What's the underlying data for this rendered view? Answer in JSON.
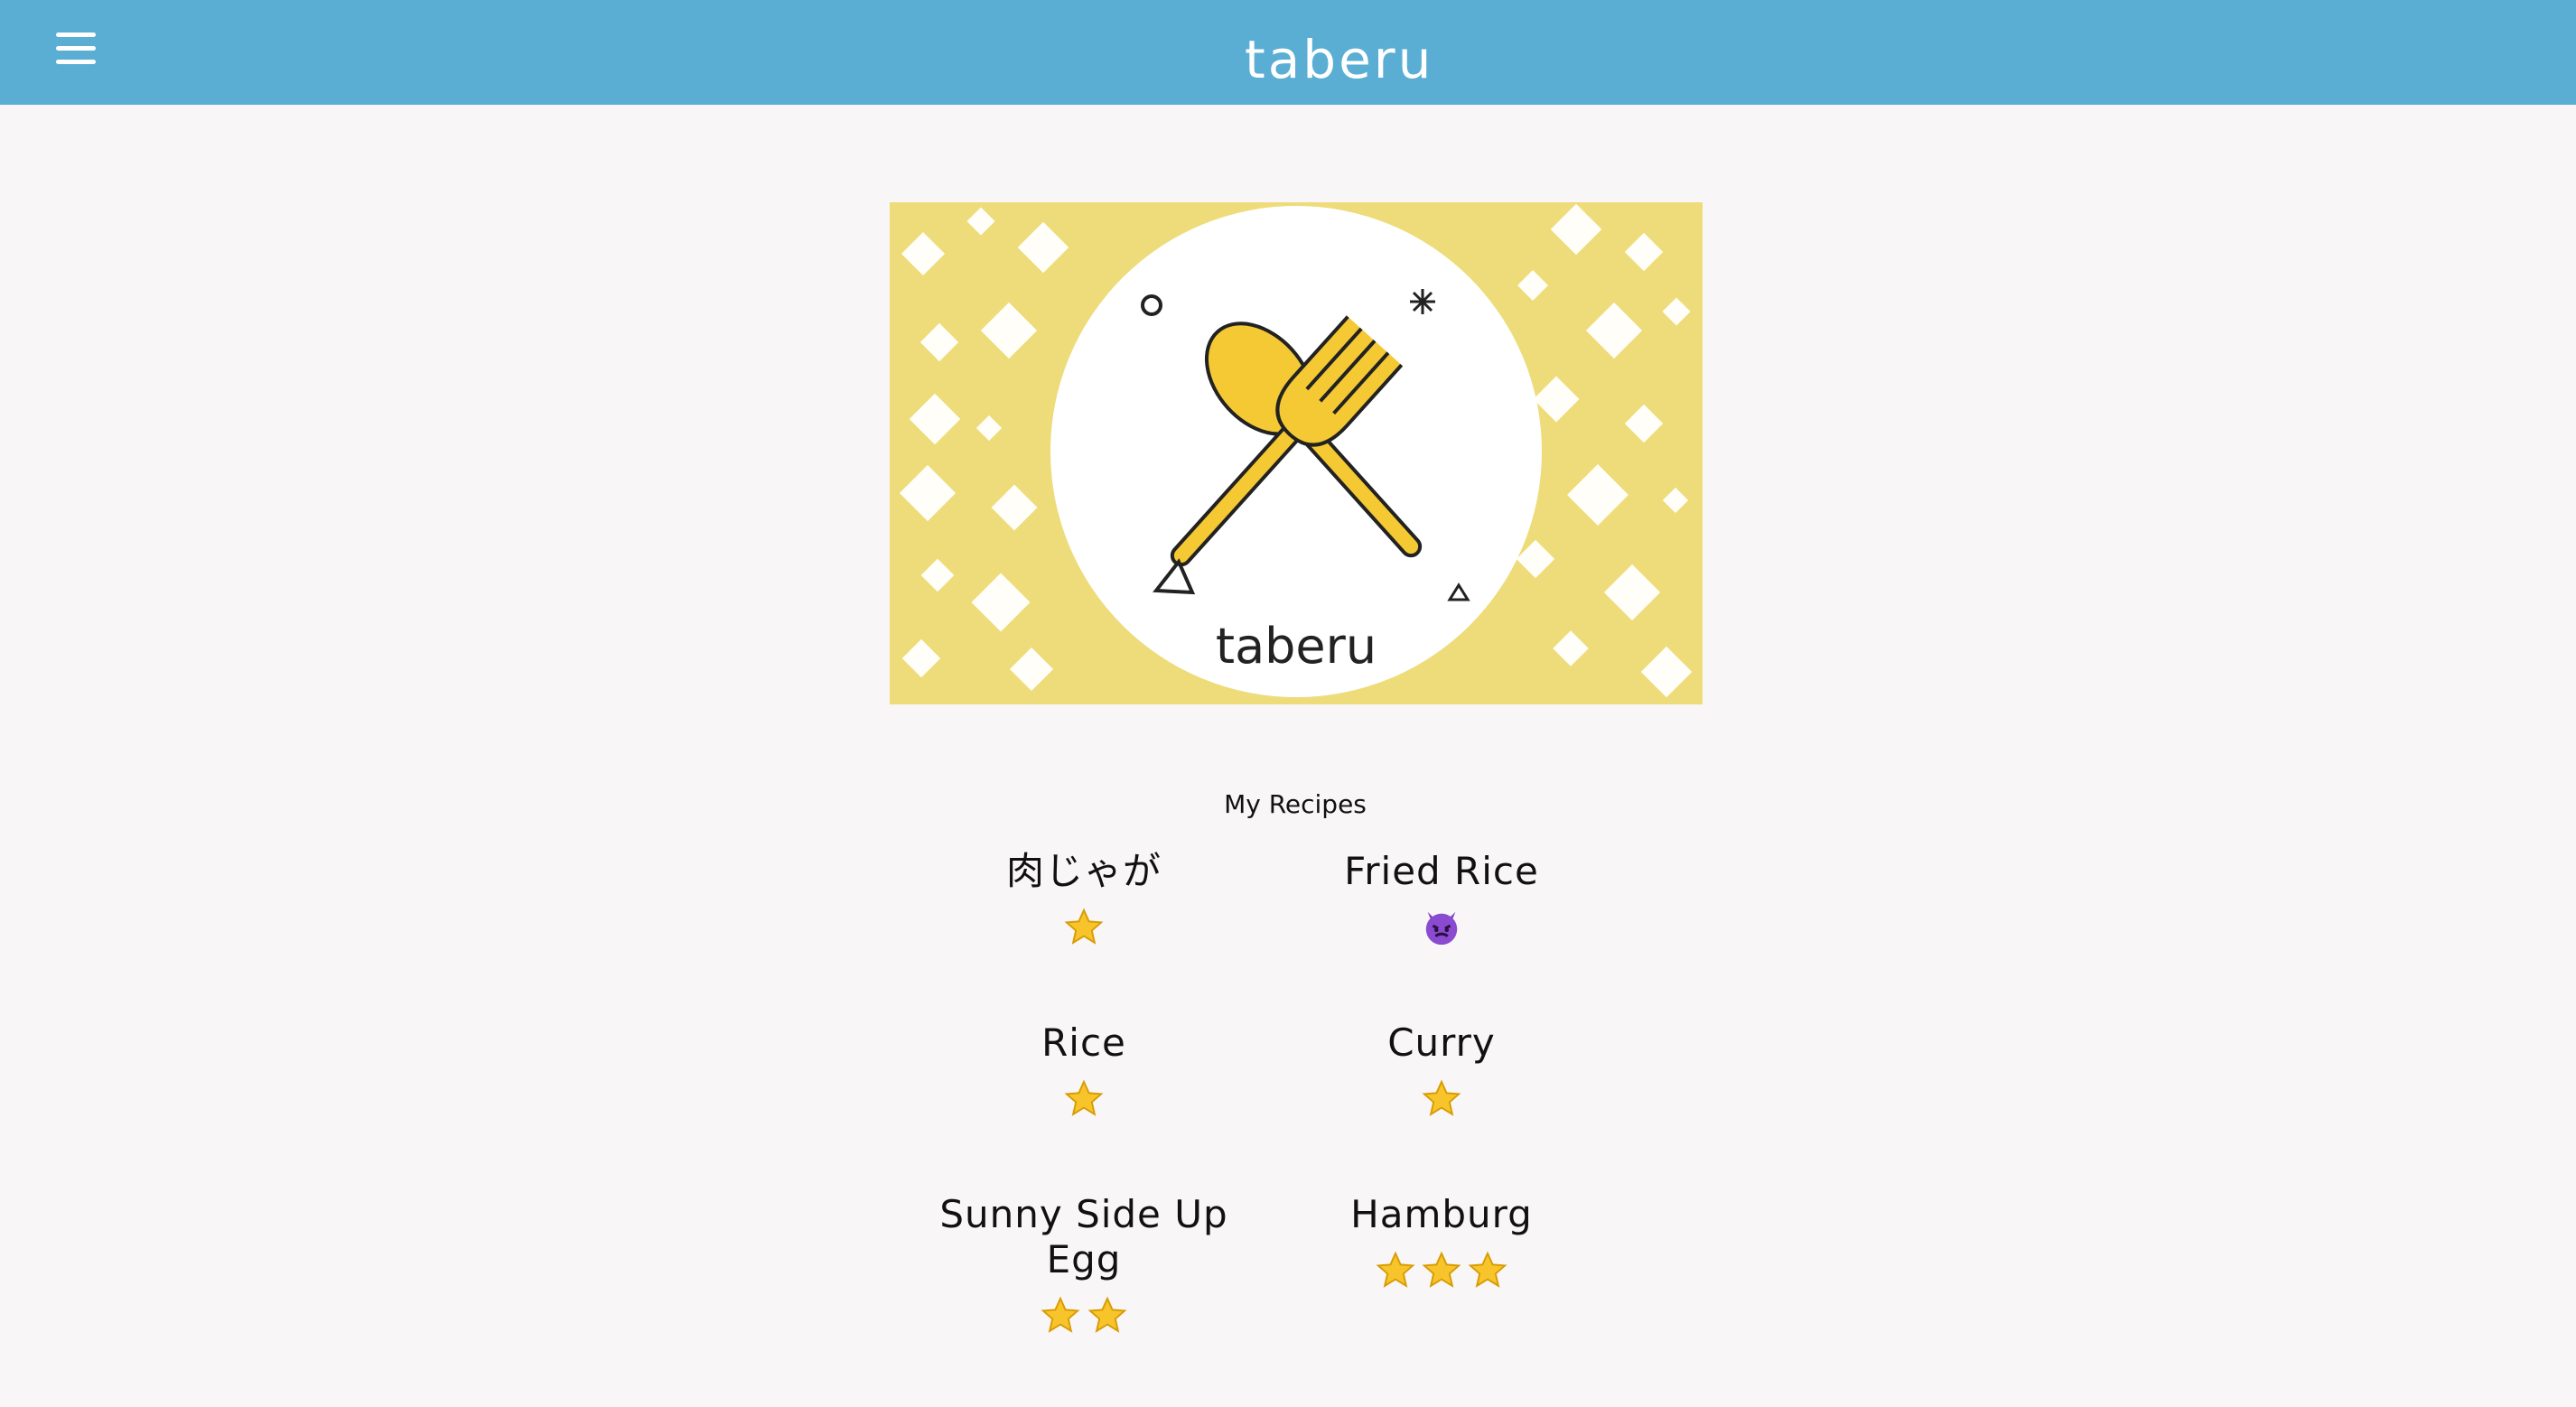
{
  "app": {
    "brand": "taberu"
  },
  "banner": {
    "logo_text": "taberu",
    "accent": "#eedc7a"
  },
  "colors": {
    "header": "#5aaed3",
    "background": "#f8f6f7",
    "star": "#f7c52b"
  },
  "section": {
    "title": "My Recipes"
  },
  "recipes": [
    {
      "name": "肉じゃが",
      "rating_icon": "star-icon",
      "rating": 1
    },
    {
      "name": "Fried Rice",
      "rating_icon": "devil-face-icon",
      "rating": 1
    },
    {
      "name": "Rice",
      "rating_icon": "star-icon",
      "rating": 1
    },
    {
      "name": "Curry",
      "rating_icon": "star-icon",
      "rating": 1
    },
    {
      "name": "Sunny Side Up Egg",
      "rating_icon": "star-icon",
      "rating": 2
    },
    {
      "name": "Hamburg",
      "rating_icon": "star-icon",
      "rating": 3
    }
  ]
}
